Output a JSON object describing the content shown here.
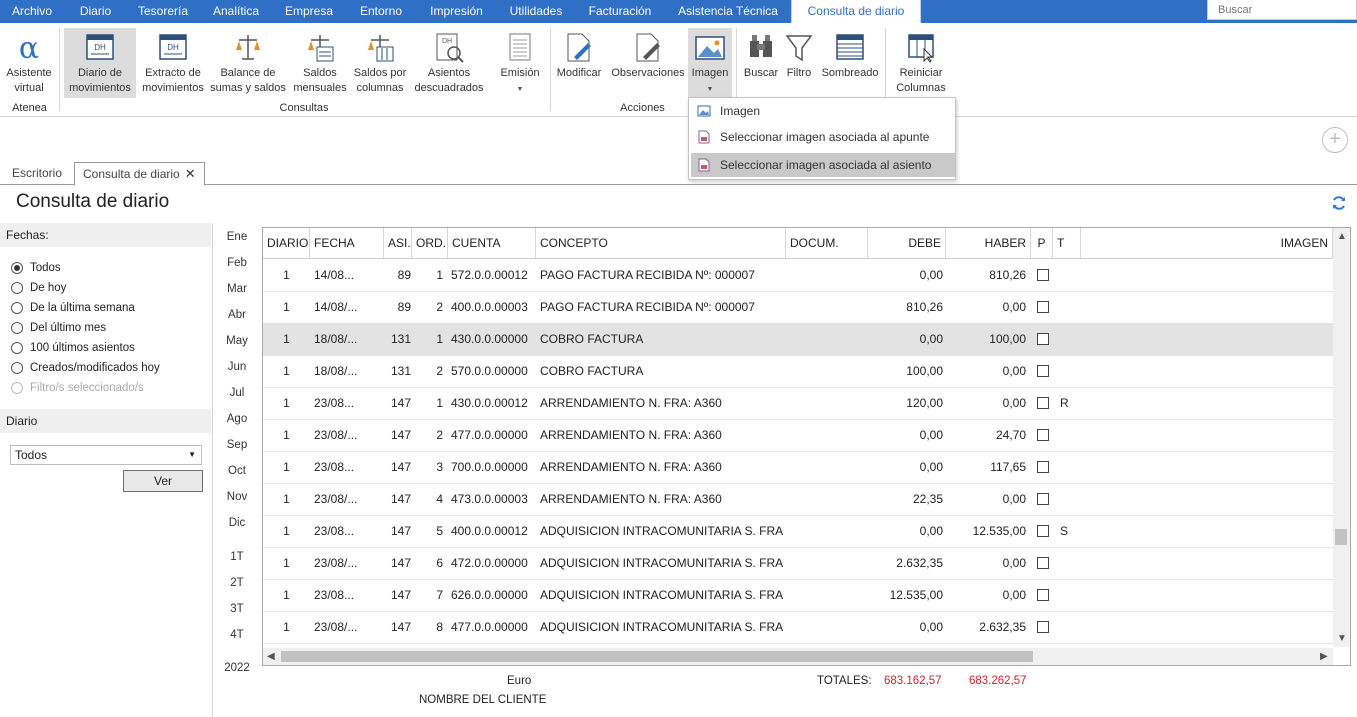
{
  "menu": {
    "items": [
      "Archivo",
      "Diario",
      "Tesorería",
      "Analítica",
      "Empresa",
      "Entorno",
      "Impresión",
      "Utilidades",
      "Facturación",
      "Asistencia Técnica",
      "Consulta de diario"
    ],
    "search_placeholder": "Buscar"
  },
  "ribbon": {
    "buttons": {
      "asistente": "Asistente\nvirtual",
      "diario_mov": "Diario de\nmovimientos",
      "extracto": "Extracto de\nmovimientos",
      "balance": "Balance de\nsumas y saldos",
      "saldos_mens": "Saldos\nmensuales",
      "saldos_col": "Saldos por\ncolumnas",
      "asientos_desc": "Asientos\ndescuadrados",
      "emision": "Emisión",
      "modificar": "Modificar",
      "observaciones": "Observaciones",
      "imagen": "Imagen",
      "buscar": "Buscar",
      "filtro": "Filtro",
      "sombreado": "Sombreado",
      "reiniciar": "Reiniciar\nColumnas"
    },
    "groups": {
      "atenea": "Atenea",
      "consultas": "Consultas",
      "acciones": "Acciones"
    },
    "imagen_menu": [
      "Imagen",
      "Seleccionar imagen asociada al apunte",
      "Seleccionar imagen asociada al asiento"
    ]
  },
  "tabs": {
    "escritorio": "Escritorio",
    "consulta": "Consulta de diario",
    "close": "✕"
  },
  "page_title": "Consulta de diario",
  "left": {
    "fechas_label": "Fechas:",
    "fechas_options": [
      "Todos",
      "De hoy",
      "De la última semana",
      "Del último mes",
      "100 últimos asientos",
      "Creados/modificados hoy",
      "Filtro/s seleccionado/s"
    ],
    "diario_label": "Diario",
    "diario_value": "Todos",
    "ver_label": "Ver"
  },
  "months": [
    "Ene",
    "Feb",
    "Mar",
    "Abr",
    "May",
    "Jun",
    "Jul",
    "Ago",
    "Sep",
    "Oct",
    "Nov",
    "Dic",
    "1T",
    "2T",
    "3T",
    "4T",
    "2022"
  ],
  "table": {
    "headers": [
      "DIARIO",
      "FECHA",
      "ASI.",
      "ORD.",
      "CUENTA",
      "CONCEPTO",
      "DOCUM.",
      "DEBE",
      "HABER",
      "P",
      "T",
      "IMAGEN"
    ],
    "rows": [
      [
        "1",
        "14/08...",
        "89",
        "1",
        "572.0.0.00012",
        "PAGO FACTURA RECIBIDA Nº: 000007",
        "",
        "0,00",
        "810,26",
        ""
      ],
      [
        "1",
        "14/08/...",
        "89",
        "2",
        "400.0.0.00003",
        "PAGO FACTURA RECIBIDA Nº: 000007",
        "",
        "810,26",
        "0,00",
        ""
      ],
      [
        "1",
        "18/08/...",
        "131",
        "1",
        "430.0.0.00000",
        "COBRO FACTURA",
        "",
        "0,00",
        "100,00",
        ""
      ],
      [
        "1",
        "18/08/...",
        "131",
        "2",
        "570.0.0.00000",
        "COBRO FACTURA",
        "",
        "100,00",
        "0,00",
        ""
      ],
      [
        "1",
        "23/08...",
        "147",
        "1",
        "430.0.0.00012",
        "ARRENDAMIENTO N. FRA:  A360",
        "",
        "120,00",
        "0,00",
        "R"
      ],
      [
        "1",
        "23/08/...",
        "147",
        "2",
        "477.0.0.00000",
        "ARRENDAMIENTO N. FRA:  A360",
        "",
        "0,00",
        "24,70",
        ""
      ],
      [
        "1",
        "23/08...",
        "147",
        "3",
        "700.0.0.00000",
        "ARRENDAMIENTO N. FRA:  A360",
        "",
        "0,00",
        "117,65",
        ""
      ],
      [
        "1",
        "23/08/...",
        "147",
        "4",
        "473.0.0.00003",
        "ARRENDAMIENTO N. FRA:  A360",
        "",
        "22,35",
        "0,00",
        ""
      ],
      [
        "1",
        "23/08...",
        "147",
        "5",
        "400.0.0.00012",
        "ADQUISICION INTRACOMUNITARIA S. FRA: ...",
        "",
        "0,00",
        "12.535,00",
        "S"
      ],
      [
        "1",
        "23/08/...",
        "147",
        "6",
        "472.0.0.00000",
        "ADQUISICION INTRACOMUNITARIA S. FRA: ...",
        "",
        "2.632,35",
        "0,00",
        ""
      ],
      [
        "1",
        "23/08...",
        "147",
        "7",
        "626.0.0.00000",
        "ADQUISICION INTRACOMUNITARIA S. FRA: ...",
        "",
        "12.535,00",
        "0,00",
        ""
      ],
      [
        "1",
        "23/08/...",
        "147",
        "8",
        "477.0.0.00000",
        "ADQUISICION INTRACOMUNITARIA S. FRA: ...",
        "",
        "0,00",
        "2.632,35",
        ""
      ]
    ],
    "selected_row": 2
  },
  "footer": {
    "euro": "Euro",
    "cliente": "NOMBRE DEL CLIENTE",
    "totales_label": "TOTALES:",
    "total_debe": "683.162,57",
    "total_haber": "683.262,57"
  },
  "colors": {
    "accent": "#2f6fc6",
    "total": "#d2222a"
  }
}
